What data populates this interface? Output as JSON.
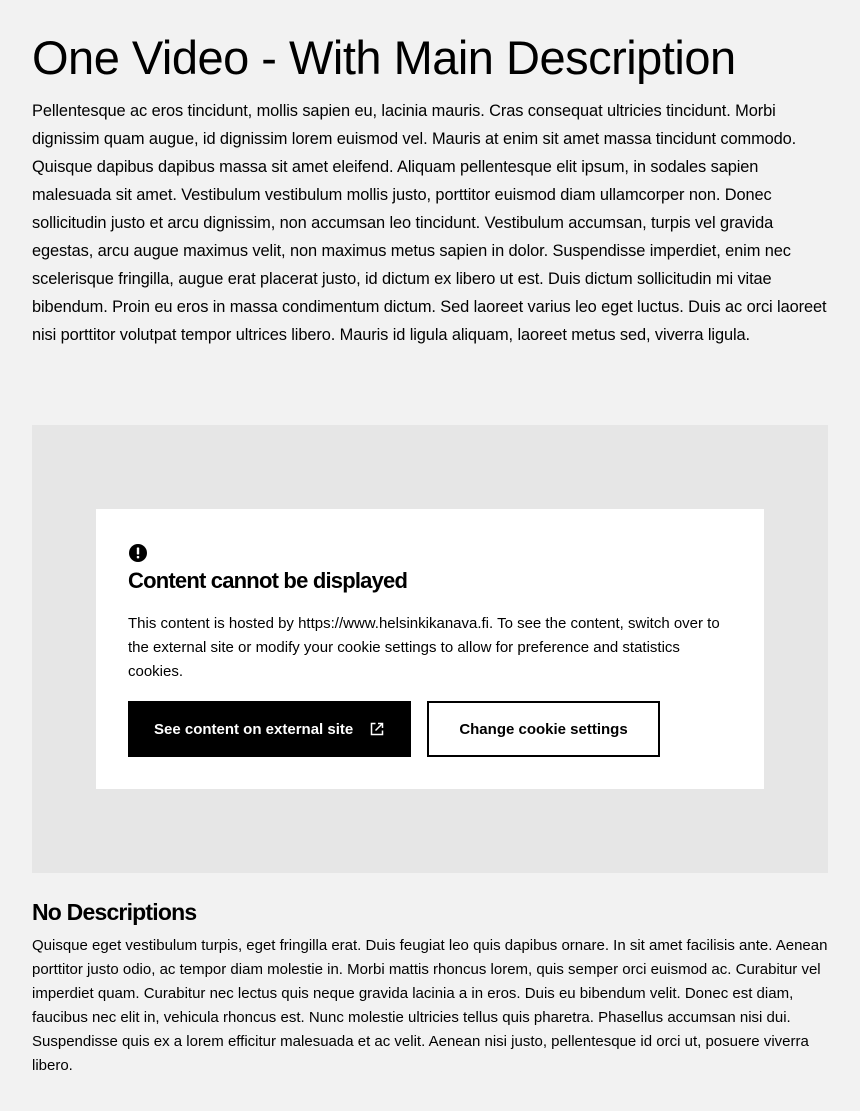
{
  "page": {
    "title": "One Video - With Main Description",
    "description": "Pellentesque ac eros tincidunt, mollis sapien eu, lacinia mauris. Cras consequat ultricies tincidunt. Morbi dignissim quam augue, id dignissim lorem euismod vel. Mauris at enim sit amet massa tincidunt commodo. Quisque dapibus dapibus massa sit amet eleifend. Aliquam pellentesque elit ipsum, in sodales sapien malesuada sit amet. Vestibulum vestibulum mollis justo, porttitor euismod diam ullamcorper non. Donec sollicitudin justo et arcu dignissim, non accumsan leo tincidunt. Vestibulum accumsan, turpis vel gravida egestas, arcu augue maximus velit, non maximus metus sapien in dolor. Suspendisse imperdiet, enim nec scelerisque fringilla, augue erat placerat justo, id dictum ex libero ut est. Duis dictum sollicitudin mi vitae bibendum. Proin eu eros in massa condimentum dictum. Sed laoreet varius leo eget luctus. Duis ac orci laoreet nisi porttitor volutpat tempor ultrices libero. Mauris id ligula aliquam, laoreet metus sed, viverra ligula."
  },
  "embed_notice": {
    "icon": "alert-circle-icon",
    "title": "Content cannot be displayed",
    "text": "This content is hosted by https://www.helsinkikanava.fi. To see the content, switch over to the external site or modify your cookie settings to allow for preference and statistics cookies.",
    "external_button_label": "See content on external site",
    "external_button_icon": "external-link-icon",
    "cookie_button_label": "Change cookie settings"
  },
  "no_descriptions": {
    "title": "No Descriptions",
    "text": "Quisque eget vestibulum turpis, eget fringilla erat. Duis feugiat leo quis dapibus ornare. In sit amet facilisis ante. Aenean porttitor justo odio, ac tempor diam molestie in. Morbi mattis rhoncus lorem, quis semper orci euismod ac. Curabitur vel imperdiet quam. Curabitur nec lectus quis neque gravida lacinia a in eros. Duis eu bibendum velit. Donec est diam, faucibus nec elit in, vehicula rhoncus est. Nunc molestie ultricies tellus quis pharetra. Phasellus accumsan nisi dui. Suspendisse quis ex a lorem efficitur malesuada et ac velit. Aenean nisi justo, pellentesque id orci ut, posuere viverra libero."
  },
  "colors": {
    "page_background": "#f2f2f2",
    "video_placeholder": "#e6e6e6",
    "notice_background": "#ffffff",
    "primary": "#000000"
  }
}
